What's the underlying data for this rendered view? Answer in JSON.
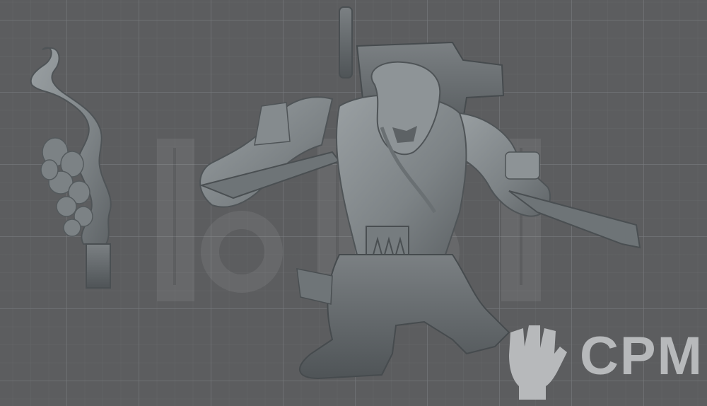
{
  "scene": {
    "subject": "miniature-model-render",
    "background_color": "#5c5d5f",
    "grid_color": "#7a7c80",
    "model_color": "#8a8f92"
  },
  "watermark": {
    "brand": "CPM",
    "icon": "raised-fist-icon",
    "color": "#b7b9bb"
  }
}
